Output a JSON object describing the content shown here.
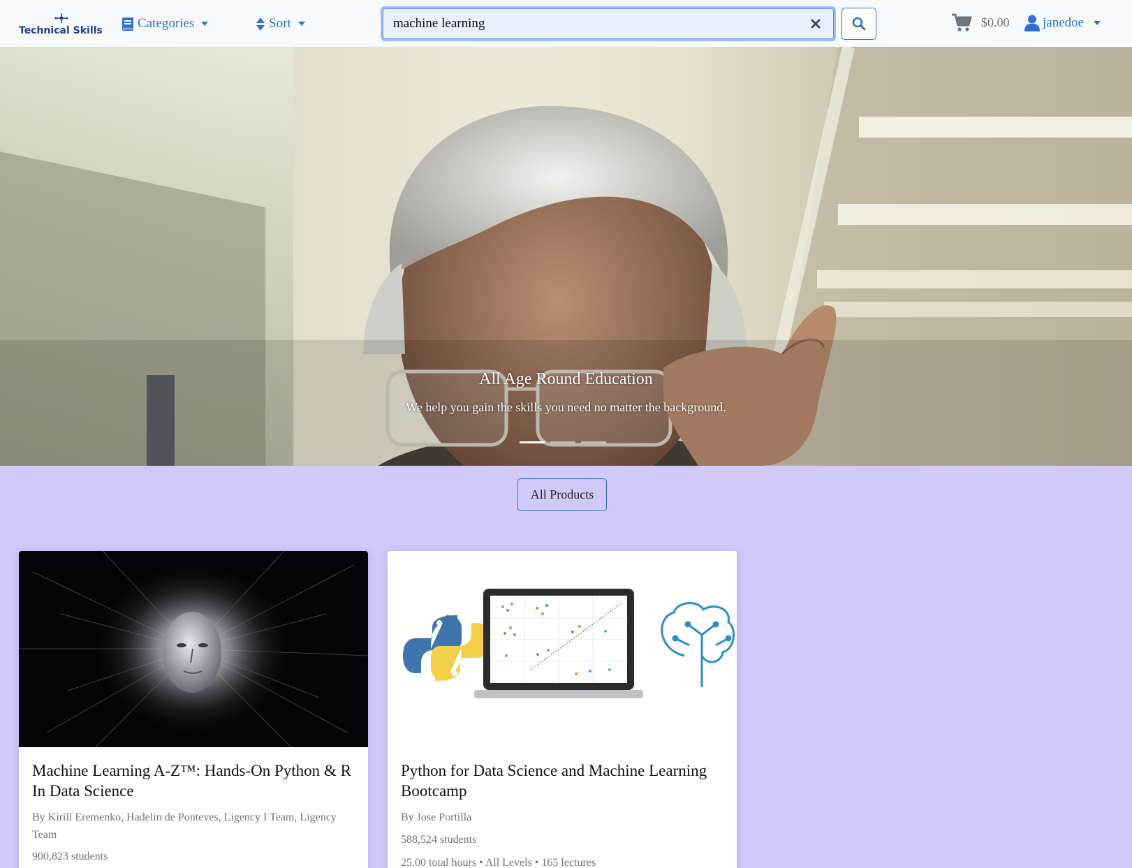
{
  "brand": {
    "name": "Technical Skills"
  },
  "nav": {
    "categories_label": "Categories",
    "sort_label": "Sort"
  },
  "search": {
    "value": "machine learning",
    "placeholder": "Search"
  },
  "cart": {
    "total": "$0.00"
  },
  "user": {
    "name": "janedoe"
  },
  "hero": {
    "title": "All Age Round Education",
    "subtitle": "We help you gain the skills you need no matter the background.",
    "active_slide": 1,
    "slide_count": 3
  },
  "all_products_label": "All Products",
  "products": [
    {
      "title": "Machine Learning A-Z™: Hands-On Python & R In Data Science",
      "author": "By Kirill Eremenko, Hadelin de Ponteves, Ligency I Team, Ligency Team",
      "students": "900,823 students"
    },
    {
      "title": "Python for Data Science and Machine Learning Bootcamp",
      "author": "By Jose Portilla",
      "students": "588,524 students",
      "meta": "25.00 total hours • All Levels • 165 lectures"
    }
  ],
  "colors": {
    "accent": "#2f6fd6",
    "page_bg": "#d1c9f7",
    "navbar_bg": "#f8f9fa",
    "muted": "#6c757d"
  }
}
